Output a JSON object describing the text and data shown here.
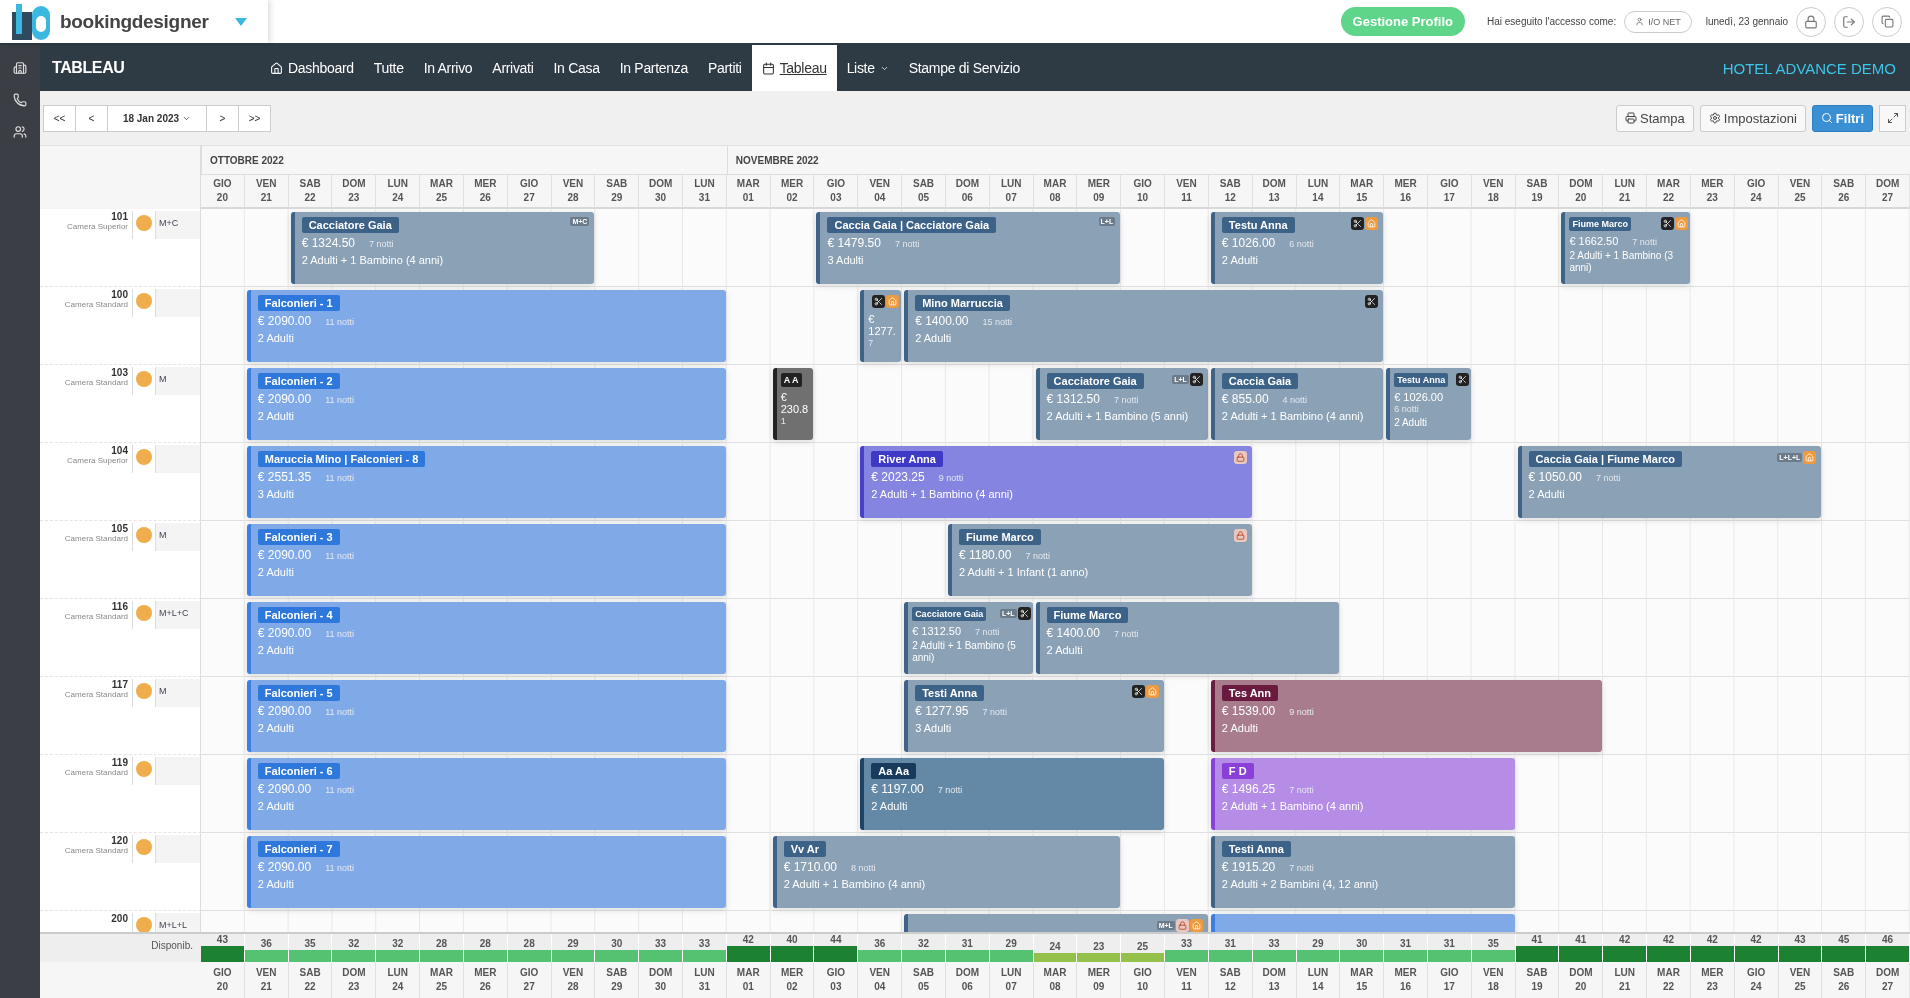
{
  "header": {
    "brand": "bookingdesigner",
    "profile_button": "Gestione Profilo",
    "login_label": "Hai eseguito l'accesso come:",
    "user": "I/O NET",
    "date": "lunedì, 23 gennaio"
  },
  "nav": {
    "title": "TABLEAU",
    "hotel": "HOTEL ADVANCE DEMO",
    "items": [
      {
        "label": "Dashboard",
        "selected": false
      },
      {
        "label": "Tutte",
        "selected": false
      },
      {
        "label": "In Arrivo",
        "selected": false
      },
      {
        "label": "Arrivati",
        "selected": false
      },
      {
        "label": "In Casa",
        "selected": false
      },
      {
        "label": "In Partenza",
        "selected": false
      },
      {
        "label": "Partiti",
        "selected": false
      },
      {
        "label": "Tableau",
        "selected": true
      },
      {
        "label": "Liste",
        "dropdown": true,
        "selected": false
      },
      {
        "label": "Stampe di Servizio",
        "selected": false
      }
    ]
  },
  "toolbar": {
    "prev_buttons": [
      "<<",
      "<"
    ],
    "date": "18 Jan 2023",
    "next_buttons": [
      ">",
      ">>"
    ],
    "actions": [
      {
        "label": "Stampa",
        "primary": false
      },
      {
        "label": "Impostazioni",
        "primary": false
      },
      {
        "label": "Filtri",
        "primary": true
      }
    ]
  },
  "months": [
    {
      "label": "OTTOBRE 2022",
      "days": [
        {
          "weekday": "GIO",
          "date": "20"
        },
        {
          "weekday": "VEN",
          "date": "21"
        },
        {
          "weekday": "SAB",
          "date": "22"
        },
        {
          "weekday": "DOM",
          "date": "23"
        },
        {
          "weekday": "LUN",
          "date": "24"
        },
        {
          "weekday": "MAR",
          "date": "25"
        },
        {
          "weekday": "MER",
          "date": "26"
        },
        {
          "weekday": "GIO",
          "date": "27"
        },
        {
          "weekday": "VEN",
          "date": "28"
        },
        {
          "weekday": "SAB",
          "date": "29"
        },
        {
          "weekday": "DOM",
          "date": "30"
        },
        {
          "weekday": "LUN",
          "date": "31"
        }
      ]
    },
    {
      "label": "NOVEMBRE 2022",
      "days": [
        {
          "weekday": "MAR",
          "date": "01"
        },
        {
          "weekday": "MER",
          "date": "02"
        },
        {
          "weekday": "GIO",
          "date": "03"
        },
        {
          "weekday": "VEN",
          "date": "04"
        },
        {
          "weekday": "SAB",
          "date": "05"
        },
        {
          "weekday": "DOM",
          "date": "06"
        },
        {
          "weekday": "LUN",
          "date": "07"
        },
        {
          "weekday": "MAR",
          "date": "08"
        },
        {
          "weekday": "MER",
          "date": "09"
        },
        {
          "weekday": "GIO",
          "date": "10"
        },
        {
          "weekday": "VEN",
          "date": "11"
        },
        {
          "weekday": "SAB",
          "date": "12"
        },
        {
          "weekday": "DOM",
          "date": "13"
        },
        {
          "weekday": "LUN",
          "date": "14"
        },
        {
          "weekday": "MAR",
          "date": "15"
        },
        {
          "weekday": "MER",
          "date": "16"
        },
        {
          "weekday": "GIO",
          "date": "17"
        },
        {
          "weekday": "VEN",
          "date": "18"
        },
        {
          "weekday": "SAB",
          "date": "19"
        },
        {
          "weekday": "DOM",
          "date": "20"
        },
        {
          "weekday": "LUN",
          "date": "21"
        },
        {
          "weekday": "MAR",
          "date": "22"
        },
        {
          "weekday": "MER",
          "date": "23"
        },
        {
          "weekday": "GIO",
          "date": "24"
        },
        {
          "weekday": "VEN",
          "date": "25"
        },
        {
          "weekday": "SAB",
          "date": "26"
        },
        {
          "weekday": "DOM",
          "date": "27"
        }
      ]
    }
  ],
  "rooms": [
    {
      "number": "101",
      "type": "Camera Superior",
      "code": "M+C",
      "bookings": [
        {
          "kind": "standard",
          "name": "Cacciatore Gaia",
          "price": "€ 1324.50",
          "nights": "7 notti",
          "guests": "2 Adulti +  1 Bambino (4 anni)",
          "badge": "M+C"
        },
        {
          "kind": "standard",
          "name": "Caccia Gaia | Cacciatore Gaia",
          "price": "€ 1479.50",
          "nights": "7 notti",
          "guests": "3 Adulti",
          "badge": "L+L"
        },
        {
          "kind": "standard",
          "name": "Testu Anna",
          "price": "€ 1026.00",
          "nights": "6 notti",
          "guests": "2 Adulti",
          "split": true,
          "online": true
        },
        {
          "kind": "standard",
          "name": "Fiume Marco",
          "price": "€ 1662.50",
          "nights": "7 notti",
          "guests": "2 Adulti +  1 Bambino (3 anni)",
          "split": true,
          "online": true
        }
      ]
    },
    {
      "number": "100",
      "type": "Camera Standard",
      "bookings": [
        {
          "kind": "group",
          "name": "Falconieri - 1",
          "price": "€ 2090.00",
          "nights": "11 notti",
          "guests": "2 Adulti"
        },
        {
          "kind": "standard",
          "price": "€ 1277.",
          "nights": "7",
          "split": true,
          "online": true
        },
        {
          "kind": "standard",
          "name": "Mino Marruccia",
          "price": "€ 1400.00",
          "nights": "15 notti",
          "guests": "2 Adulti",
          "split": true
        }
      ]
    },
    {
      "number": "103",
      "type": "Camera Standard",
      "code": "M",
      "bookings": [
        {
          "kind": "group",
          "name": "Falconieri - 2",
          "price": "€ 2090.00",
          "nights": "11 notti",
          "guests": "2 Adulti"
        },
        {
          "kind": "blocked",
          "name": "A A",
          "price": "€ 230.8",
          "nights": "1"
        },
        {
          "kind": "standard",
          "name": "Cacciatore Gaia",
          "price": "€ 1312.50",
          "nights": "7 notti",
          "guests": "2 Adulti +  1 Bambino (5 anni)",
          "badge": "L+L",
          "split": true
        },
        {
          "kind": "standard",
          "name": "Caccia Gaia",
          "price": "€ 855.00",
          "nights": "4 notti",
          "guests": "2 Adulti +  1 Bambino (4 anni)"
        },
        {
          "kind": "standard",
          "name": "Testu Anna",
          "price": "€ 1026.00",
          "nights": "6 notti",
          "guests": "2 Adulti",
          "split": true
        }
      ]
    },
    {
      "number": "104",
      "type": "Camera Superior",
      "bookings": [
        {
          "kind": "group",
          "name": "Maruccia Mino | Falconieri - 8",
          "price": "€ 2551.35",
          "nights": "11 notti",
          "guests": "3 Adulti"
        },
        {
          "kind": "violet",
          "name": "River Anna",
          "price": "€ 2023.25",
          "nights": "9 notti",
          "guests": "2 Adulti +  1 Bambino (4 anni)",
          "locked": true
        },
        {
          "kind": "standard",
          "name": "Caccia Gaia | Fiume Marco",
          "price": "€ 1050.00",
          "nights": "7 notti",
          "guests": "2 Adulti",
          "badge": "L+L+L",
          "online": true
        }
      ]
    },
    {
      "number": "105",
      "type": "Camera Standard",
      "code": "M",
      "bookings": [
        {
          "kind": "group",
          "name": "Falconieri - 3",
          "price": "€ 2090.00",
          "nights": "11 notti",
          "guests": "2 Adulti"
        },
        {
          "kind": "standard",
          "name": "Fiume Marco",
          "price": "€ 1180.00",
          "nights": "7 notti",
          "guests": "2 Adulti +  1 Infant (1 anno)",
          "locked": true
        }
      ]
    },
    {
      "number": "116",
      "type": "Camera Standard",
      "code": "M+L+C",
      "bookings": [
        {
          "kind": "group",
          "name": "Falconieri - 4",
          "price": "€ 2090.00",
          "nights": "11 notti",
          "guests": "2 Adulti"
        },
        {
          "kind": "standard",
          "name": "Cacciatore Gaia",
          "price": "€ 1312.50",
          "nights": "7 notti",
          "guests": "2 Adulti +  1 Bambino (5 anni)",
          "badge": "L+L",
          "split": true
        },
        {
          "kind": "standard",
          "name": "Fiume Marco",
          "price": "€ 1400.00",
          "nights": "7 notti",
          "guests": "2 Adulti"
        }
      ]
    },
    {
      "number": "117",
      "type": "Camera Standard",
      "code": "M",
      "bookings": [
        {
          "kind": "group",
          "name": "Falconieri - 5",
          "price": "€ 2090.00",
          "nights": "11 notti",
          "guests": "2 Adulti"
        },
        {
          "kind": "standard",
          "name": "Testi Anna",
          "price": "€ 1277.95",
          "nights": "7 notti",
          "guests": "3 Adulti",
          "split": true,
          "online": true
        },
        {
          "kind": "mauve",
          "name": "Tes Ann",
          "price": "€ 1539.00",
          "nights": "9 notti",
          "guests": "2 Adulti"
        }
      ]
    },
    {
      "number": "119",
      "type": "Camera Standard",
      "bookings": [
        {
          "kind": "group",
          "name": "Falconieri - 6",
          "price": "€ 2090.00",
          "nights": "11 notti",
          "guests": "2 Adulti"
        },
        {
          "kind": "dark",
          "name": "Aa Aa",
          "price": "€ 1197.00",
          "nights": "7 notti",
          "guests": "2 Adulti"
        },
        {
          "kind": "lilac",
          "name": "F D",
          "price": "€ 1496.25",
          "nights": "7 notti",
          "guests": "2 Adulti +  1 Bambino (4 anni)"
        }
      ]
    },
    {
      "number": "120",
      "type": "Camera Standard",
      "bookings": [
        {
          "kind": "group",
          "name": "Falconieri - 7",
          "price": "€ 2090.00",
          "nights": "11 notti",
          "guests": "2 Adulti"
        },
        {
          "kind": "standard",
          "name": "Vv Ar",
          "price": "€ 1710.00",
          "nights": "8 notti",
          "guests": "2 Adulti +  1 Bambino (4 anni)"
        },
        {
          "kind": "standard",
          "name": "Testi Anna",
          "price": "€ 1915.20",
          "nights": "7 notti",
          "guests": "2 Adulti +  2 Bambini (4, 12 anni)"
        }
      ]
    },
    {
      "number": "200",
      "code": "M+L+L",
      "bookings": [
        {
          "kind": "standard",
          "badge": "M+L",
          "locked": true,
          "online": true
        },
        {
          "kind": "group"
        }
      ]
    }
  ],
  "availability": {
    "label": "Disponib.",
    "values": [
      {
        "value": "43",
        "kind": "high"
      },
      {
        "value": "36",
        "kind": "mid"
      },
      {
        "value": "35",
        "kind": "mid"
      },
      {
        "value": "32",
        "kind": "mid"
      },
      {
        "value": "32",
        "kind": "mid"
      },
      {
        "value": "28",
        "kind": "mid"
      },
      {
        "value": "28",
        "kind": "mid"
      },
      {
        "value": "28",
        "kind": "mid"
      },
      {
        "value": "29",
        "kind": "mid"
      },
      {
        "value": "30",
        "kind": "mid"
      },
      {
        "value": "33",
        "kind": "mid"
      },
      {
        "value": "33",
        "kind": "mid"
      },
      {
        "value": "42",
        "kind": "high"
      },
      {
        "value": "40",
        "kind": "high"
      },
      {
        "value": "44",
        "kind": "high"
      },
      {
        "value": "36",
        "kind": "mid"
      },
      {
        "value": "32",
        "kind": "mid"
      },
      {
        "value": "31",
        "kind": "mid"
      },
      {
        "value": "29",
        "kind": "mid"
      },
      {
        "value": "24",
        "kind": "low"
      },
      {
        "value": "23",
        "kind": "low"
      },
      {
        "value": "25",
        "kind": "low"
      },
      {
        "value": "33",
        "kind": "mid"
      },
      {
        "value": "31",
        "kind": "mid"
      },
      {
        "value": "33",
        "kind": "mid"
      },
      {
        "value": "29",
        "kind": "mid"
      },
      {
        "value": "30",
        "kind": "mid"
      },
      {
        "value": "31",
        "kind": "mid"
      },
      {
        "value": "31",
        "kind": "mid"
      },
      {
        "value": "35",
        "kind": "mid"
      },
      {
        "value": "41",
        "kind": "high"
      },
      {
        "value": "41",
        "kind": "high"
      },
      {
        "value": "42",
        "kind": "high"
      },
      {
        "value": "42",
        "kind": "high"
      },
      {
        "value": "42",
        "kind": "high"
      },
      {
        "value": "42",
        "kind": "high"
      },
      {
        "value": "43",
        "kind": "high"
      },
      {
        "value": "45",
        "kind": "high"
      },
      {
        "value": "46",
        "kind": "high"
      }
    ]
  },
  "footer_days": [
    {
      "weekday": "GIO",
      "date": "20"
    },
    {
      "weekday": "VEN",
      "date": "21"
    },
    {
      "weekday": "SAB",
      "date": "22"
    },
    {
      "weekday": "DOM",
      "date": "23"
    },
    {
      "weekday": "LUN",
      "date": "24"
    },
    {
      "weekday": "MAR",
      "date": "25"
    },
    {
      "weekday": "MER",
      "date": "26"
    },
    {
      "weekday": "GIO",
      "date": "27"
    },
    {
      "weekday": "VEN",
      "date": "28"
    },
    {
      "weekday": "SAB",
      "date": "29"
    },
    {
      "weekday": "DOM",
      "date": "30"
    },
    {
      "weekday": "LUN",
      "date": "31"
    },
    {
      "weekday": "MAR",
      "date": "01"
    },
    {
      "weekday": "MER",
      "date": "02"
    },
    {
      "weekday": "GIO",
      "date": "03"
    },
    {
      "weekday": "VEN",
      "date": "04"
    },
    {
      "weekday": "SAB",
      "date": "05"
    },
    {
      "weekday": "DOM",
      "date": "06"
    },
    {
      "weekday": "LUN",
      "date": "07"
    },
    {
      "weekday": "MAR",
      "date": "08"
    },
    {
      "weekday": "MER",
      "date": "09"
    },
    {
      "weekday": "GIO",
      "date": "10"
    },
    {
      "weekday": "VEN",
      "date": "11"
    },
    {
      "weekday": "SAB",
      "date": "12"
    },
    {
      "weekday": "DOM",
      "date": "13"
    },
    {
      "weekday": "LUN",
      "date": "14"
    },
    {
      "weekday": "MAR",
      "date": "15"
    },
    {
      "weekday": "MER",
      "date": "16"
    },
    {
      "weekday": "GIO",
      "date": "17"
    },
    {
      "weekday": "VEN",
      "date": "18"
    },
    {
      "weekday": "SAB",
      "date": "19"
    },
    {
      "weekday": "DOM",
      "date": "20"
    },
    {
      "weekday": "LUN",
      "date": "21"
    },
    {
      "weekday": "MAR",
      "date": "22"
    },
    {
      "weekday": "MER",
      "date": "23"
    },
    {
      "weekday": "GIO",
      "date": "24"
    },
    {
      "weekday": "VEN",
      "date": "25"
    },
    {
      "weekday": "SAB",
      "date": "26"
    },
    {
      "weekday": "DOM",
      "date": "27"
    }
  ]
}
